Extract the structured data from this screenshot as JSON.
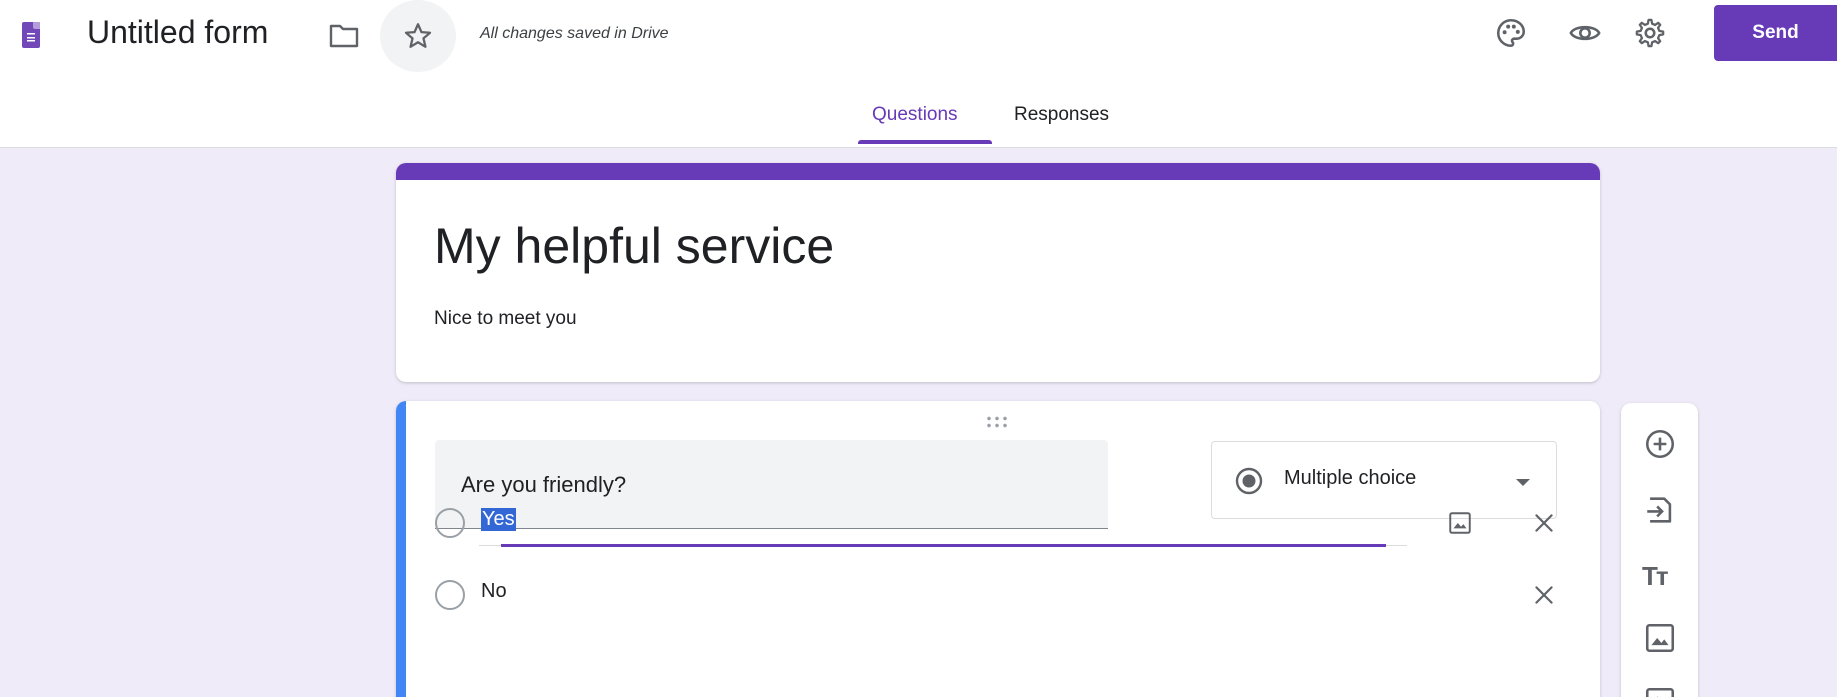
{
  "header": {
    "doc_title": "Untitled form",
    "save_status": "All changes saved in Drive",
    "send_label": "Send",
    "icons": [
      "forms-app-icon",
      "folder-icon",
      "star-icon",
      "palette-icon",
      "eye-icon",
      "gear-icon"
    ]
  },
  "tabs": [
    {
      "label": "Questions",
      "active": true
    },
    {
      "label": "Responses",
      "active": false
    }
  ],
  "form": {
    "title": "My helpful service",
    "description": "Nice to meet you"
  },
  "question": {
    "text": "Are you friendly?",
    "type": "Multiple choice",
    "options": [
      {
        "label": "Yes",
        "selected_text": true
      },
      {
        "label": "No",
        "selected_text": false
      }
    ]
  },
  "toolbar": {
    "items": [
      "add-question-icon",
      "import-questions-icon",
      "add-title-icon",
      "add-image-icon",
      "add-video-icon"
    ],
    "title_glyph": "Tт"
  },
  "colors": {
    "accent": "#673ab7",
    "background": "#f0ebf8",
    "question_focus": "#4285f4",
    "text_selection": "#3367d6"
  }
}
